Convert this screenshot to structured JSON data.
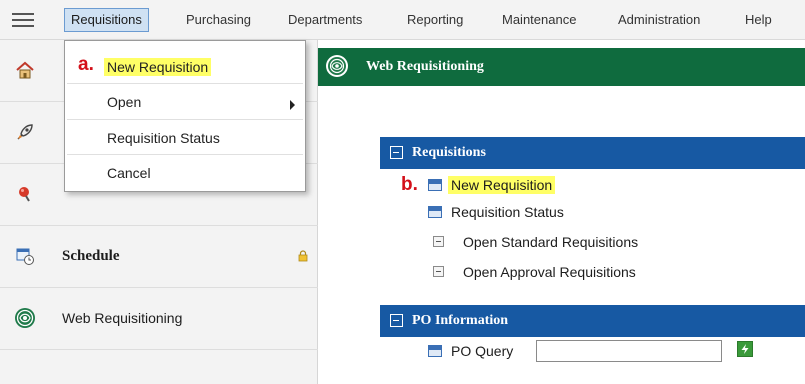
{
  "menubar": {
    "items": [
      "Requisitions",
      "Purchasing",
      "Departments",
      "Reporting",
      "Maintenance",
      "Administration",
      "Help"
    ],
    "active": "Requisitions"
  },
  "dropdown": {
    "step_label": "a.",
    "items": [
      {
        "label": "New Requisition",
        "highlighted": true
      },
      {
        "label": "Open",
        "has_submenu": true
      },
      {
        "label": "Requisition Status"
      },
      {
        "label": "Cancel"
      }
    ]
  },
  "sidebar": {
    "items": [
      {
        "icon": "home-icon",
        "label": ""
      },
      {
        "icon": "rocket-icon",
        "label": ""
      },
      {
        "icon": "pin-icon",
        "label": ""
      },
      {
        "icon": "calendar-clock-icon",
        "label": "Schedule",
        "locked": true
      },
      {
        "icon": "web-requisitioning-logo-icon",
        "label": "Web Requisitioning"
      }
    ]
  },
  "main": {
    "header_title": "Web Requisitioning",
    "requisitions": {
      "title": "Requisitions",
      "step_label": "b.",
      "links": [
        {
          "label": "New Requisition",
          "highlighted": true
        },
        {
          "label": "Requisition Status"
        }
      ],
      "sublinks": [
        "Open Standard Requisitions",
        "Open Approval Requisitions"
      ]
    },
    "po_information": {
      "title": "PO Information",
      "po_query_label": "PO Query",
      "po_query_value": ""
    }
  },
  "colors": {
    "header_green": "#0f6b3e",
    "section_blue": "#1759a3",
    "highlight_yellow": "#ffff66",
    "step_red": "#d3101a",
    "menu_active_bg": "#cfe1f3"
  }
}
